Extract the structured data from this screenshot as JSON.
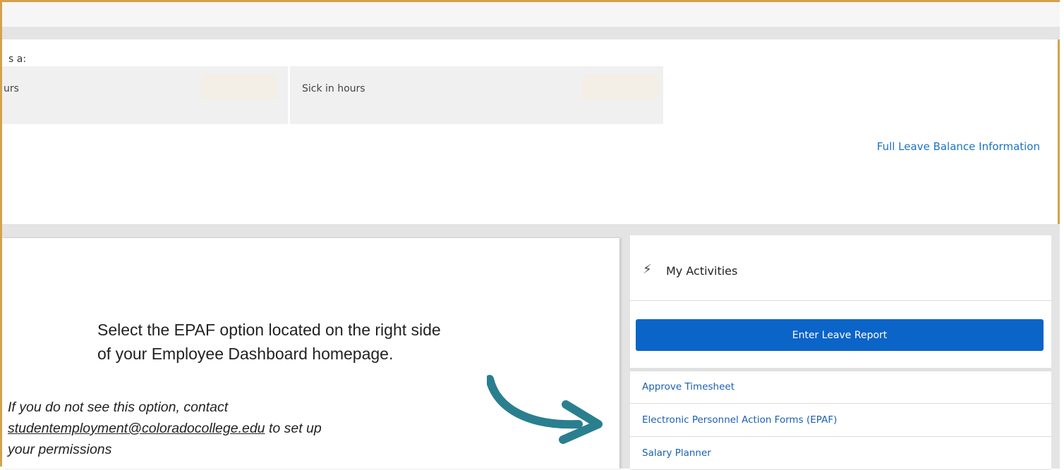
{
  "leave_balances": {
    "as_of_label": "s a:",
    "items": [
      {
        "label": "urs"
      },
      {
        "label": "Sick in hours"
      }
    ],
    "full_link": "Full Leave Balance Information"
  },
  "instruction": {
    "line1": "Select the EPAF option located on the right side",
    "line2": "of your Employee Dashboard homepage."
  },
  "note": {
    "prefix": "If you do not see this option, contact",
    "email": "studentemployment@coloradocollege.edu",
    "suffix": " to set up",
    "line3": "your permissions"
  },
  "activities": {
    "title": "My Activities",
    "icon": "wand-icon",
    "primary_button": "Enter Leave Report",
    "items": [
      {
        "label": "Approve Timesheet"
      },
      {
        "label": "Electronic Personnel Action Forms (EPAF)"
      },
      {
        "label": "Salary Planner"
      }
    ]
  },
  "colors": {
    "accent_border": "#d4a24c",
    "primary_button": "#0b64c7",
    "link": "#1a73c4",
    "arrow": "#2a7f8f"
  }
}
